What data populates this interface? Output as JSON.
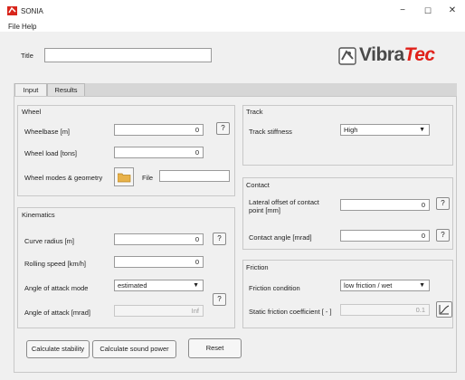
{
  "window": {
    "title": "SONIA",
    "minimize": "−",
    "maximize": "☐",
    "close": "✕"
  },
  "menu": {
    "file": "File",
    "help": "Help"
  },
  "title_field": {
    "label": "Title",
    "value": ""
  },
  "brand": {
    "logo_part1": "Vibra",
    "logo_part2": "Tec",
    "accent_color": "#e0211a"
  },
  "tabs": {
    "input": "Input",
    "results": "Results",
    "active": "Input"
  },
  "wheel": {
    "title": "Wheel",
    "wheelbase_label": "Wheelbase [m]",
    "wheelbase_value": "0",
    "wheel_load_label": "Wheel load [tons]",
    "wheel_load_value": "0",
    "modes_label": "Wheel modes & geometry",
    "file_label": "File",
    "file_value": "",
    "help": "?"
  },
  "kinematics": {
    "title": "Kinematics",
    "curve_radius_label": "Curve radius [m]",
    "curve_radius_value": "0",
    "rolling_speed_label": "Rolling speed [km/h]",
    "rolling_speed_value": "0",
    "aoa_mode_label": "Angle of attack mode",
    "aoa_mode_value": "estimated",
    "aoa_label": "Angle of attack [mrad]",
    "aoa_value": "Inf",
    "help": "?"
  },
  "track": {
    "title": "Track",
    "stiffness_label": "Track stiffness",
    "stiffness_value": "High"
  },
  "contact": {
    "title": "Contact",
    "lateral_offset_label": "Lateral offset of contact point [mm]",
    "lateral_offset_value": "0",
    "contact_angle_label": "Contact angle [mrad]",
    "contact_angle_value": "0",
    "help": "?"
  },
  "friction": {
    "title": "Friction",
    "condition_label": "Friction condition",
    "condition_value": "low friction / wet",
    "static_label": "Static friction coefficient [ - ]",
    "static_value": "0.1"
  },
  "actions": {
    "calc_stability": "Calculate stability",
    "calc_sound": "Calculate sound power",
    "reset": "Reset"
  }
}
